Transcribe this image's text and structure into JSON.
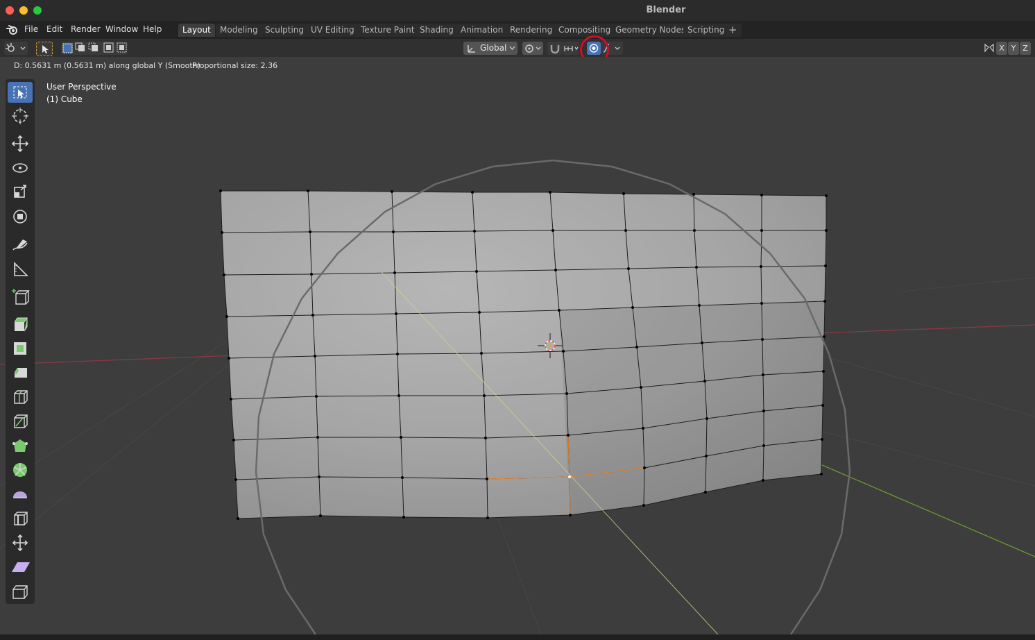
{
  "window": {
    "title": "Blender"
  },
  "menu": {
    "items": [
      "File",
      "Edit",
      "Render",
      "Window",
      "Help"
    ]
  },
  "workspaces": {
    "tabs": [
      "Layout",
      "Modeling",
      "Sculpting",
      "UV Editing",
      "Texture Paint",
      "Shading",
      "Animation",
      "Rendering",
      "Compositing",
      "Geometry Nodes",
      "Scripting"
    ],
    "active": "Layout",
    "add_label": "+"
  },
  "header": {
    "transform_orientation": "Global",
    "axis_x": "X",
    "axis_y": "Y",
    "axis_z": "Z",
    "proportional_editing_enabled": true
  },
  "status": {
    "operation": "D: 0.5631 m (0.5631 m) along global Y (Smooth)",
    "proportional_size": "Proportional size: 2.36"
  },
  "viewport": {
    "perspective_label": "User Perspective",
    "object_label": "(1) Cube"
  },
  "tools": [
    {
      "name": "select-box",
      "active": true
    },
    {
      "name": "cursor"
    },
    {
      "name": "move"
    },
    {
      "name": "rotate"
    },
    {
      "name": "scale"
    },
    {
      "name": "transform"
    },
    {
      "name": "annotate"
    },
    {
      "name": "measure"
    },
    {
      "name": "add-cube"
    },
    {
      "name": "extrude-region"
    },
    {
      "name": "inset-faces"
    },
    {
      "name": "bevel"
    },
    {
      "name": "loop-cut"
    },
    {
      "name": "knife"
    },
    {
      "name": "poly-build"
    },
    {
      "name": "spin"
    },
    {
      "name": "smooth"
    },
    {
      "name": "edge-slide"
    },
    {
      "name": "shrink-fatten"
    },
    {
      "name": "shear"
    },
    {
      "name": "rip-region"
    }
  ],
  "colors": {
    "x_axis": "#8a3a44",
    "y_axis": "#6a9a2a",
    "highlight_circle": "#c8102e",
    "active_tool": "#4772b3",
    "mesh_face": "#a8a8a8"
  }
}
